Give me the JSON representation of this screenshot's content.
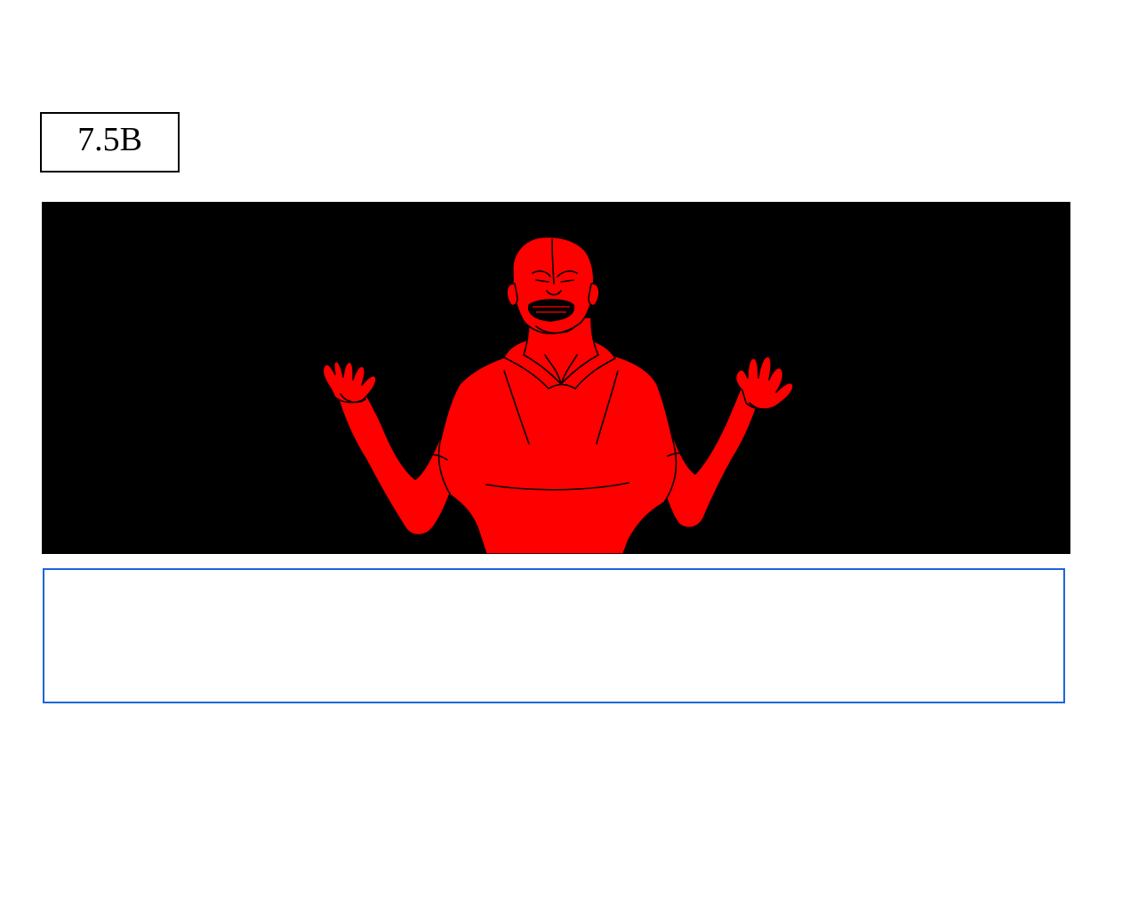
{
  "panel": {
    "number": "7.5B"
  },
  "frame": {
    "icon": "storyboard-frame",
    "background_color": "#000000",
    "figure_color": "#ff0000",
    "line_color": "#000000"
  },
  "notes": {
    "value": "",
    "placeholder": "",
    "border_color": "#1a66d9"
  }
}
